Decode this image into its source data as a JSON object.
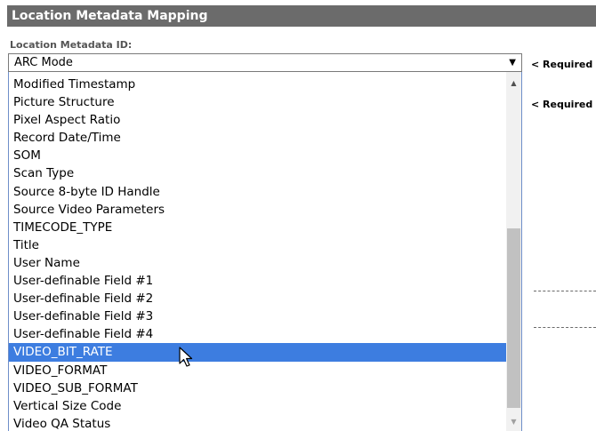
{
  "header": {
    "title": "Location Metadata Mapping"
  },
  "field": {
    "label": "Location Metadata ID:",
    "selected_value": "ARC Mode",
    "dropdown_arrow": "▼"
  },
  "required_notes": [
    "< Required",
    "< Required"
  ],
  "dropdown": {
    "items": [
      "Modified Timestamp",
      "Picture Structure",
      "Pixel Aspect Ratio",
      "Record Date/Time",
      "SOM",
      "Scan Type",
      "Source 8-byte ID Handle",
      "Source Video Parameters",
      "TIMECODE_TYPE",
      "Title",
      "User Name",
      "User-definable Field #1",
      "User-definable Field #2",
      "User-definable Field #3",
      "User-definable Field #4",
      "VIDEO_BIT_RATE",
      "VIDEO_FORMAT",
      "VIDEO_SUB_FORMAT",
      "Vertical Size Code",
      "Video QA Status"
    ],
    "highlighted_item": "VIDEO_BIT_RATE",
    "scroll_up_glyph": "▲",
    "scroll_down_glyph": "▼"
  },
  "colors": {
    "header_bg": "#6b6b6b",
    "highlight": "#3d7de0",
    "dropdown_border": "#6f8fc9"
  },
  "icons": {
    "cursor": "mouse-pointer-icon"
  }
}
